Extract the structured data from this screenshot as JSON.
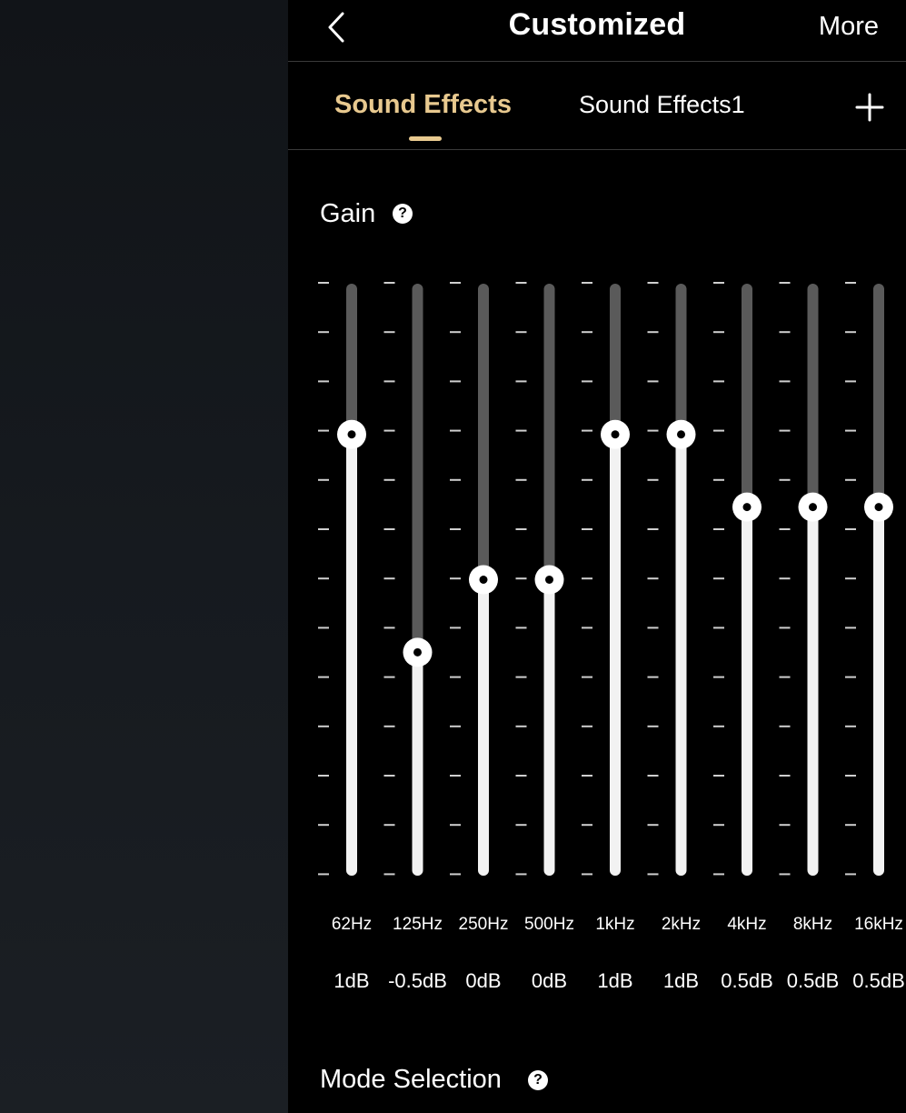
{
  "header": {
    "title": "Customized",
    "more_label": "More",
    "back_icon": "chevron-left-icon"
  },
  "tabs": [
    {
      "label": "Sound Effects",
      "active": true
    },
    {
      "label": "Sound Effects1",
      "active": false
    }
  ],
  "add_tab_icon": "plus-icon",
  "colors": {
    "accent": "#e8c98f",
    "track": "#5a5a5a",
    "fill": "#f2f2f2",
    "background": "#000000"
  },
  "gain": {
    "label": "Gain",
    "help_icon": "question-circle-icon",
    "range_db": [
      -2,
      2
    ],
    "bands": [
      {
        "freq": "62Hz",
        "value": 1,
        "value_label": "1dB"
      },
      {
        "freq": "125Hz",
        "value": -0.5,
        "value_label": "-0.5dB"
      },
      {
        "freq": "250Hz",
        "value": 0,
        "value_label": "0dB"
      },
      {
        "freq": "500Hz",
        "value": 0,
        "value_label": "0dB"
      },
      {
        "freq": "1kHz",
        "value": 1,
        "value_label": "1dB"
      },
      {
        "freq": "2kHz",
        "value": 1,
        "value_label": "1dB"
      },
      {
        "freq": "4kHz",
        "value": 0.5,
        "value_label": "0.5dB"
      },
      {
        "freq": "8kHz",
        "value": 0.5,
        "value_label": "0.5dB"
      },
      {
        "freq": "16kHz",
        "value": 0.5,
        "value_label": "0.5dB"
      }
    ]
  },
  "mode_selection": {
    "label": "Mode Selection",
    "help_icon": "question-circle-icon"
  }
}
